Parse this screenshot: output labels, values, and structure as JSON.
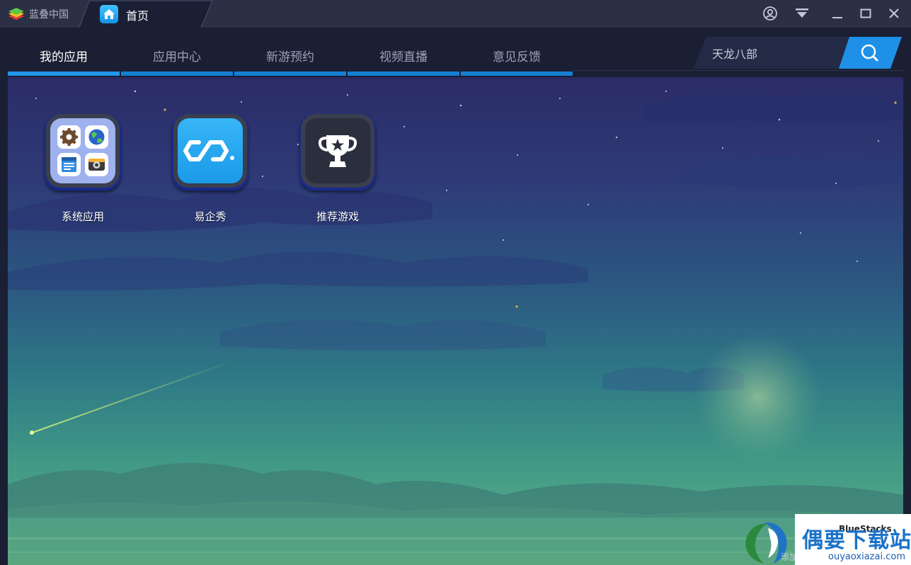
{
  "titlebar": {
    "brand_label": "蓝叠中国",
    "home_tab_label": "首页"
  },
  "nav": {
    "tabs": [
      {
        "label": "我的应用",
        "active": true
      },
      {
        "label": "应用中心",
        "active": false
      },
      {
        "label": "新游预约",
        "active": false
      },
      {
        "label": "视频直播",
        "active": false
      },
      {
        "label": "意见反馈",
        "active": false
      }
    ],
    "search_value": "天龙八部"
  },
  "apps": [
    {
      "label": "系统应用",
      "icon": "system-apps-folder-icon"
    },
    {
      "label": "易企秀",
      "icon": "eqxiu-logo-icon"
    },
    {
      "label": "推荐游戏",
      "icon": "trophy-icon"
    }
  ],
  "watermark": {
    "title": "偶要下载站",
    "subtitle": "BlueStacks",
    "url": "ouyaoxiazai.com",
    "cn_hint": "添加"
  },
  "colors": {
    "accent": "#2196ec",
    "titlebar": "#2c3045",
    "navbar": "#1b1f33",
    "search_button": "#1e90e8"
  }
}
